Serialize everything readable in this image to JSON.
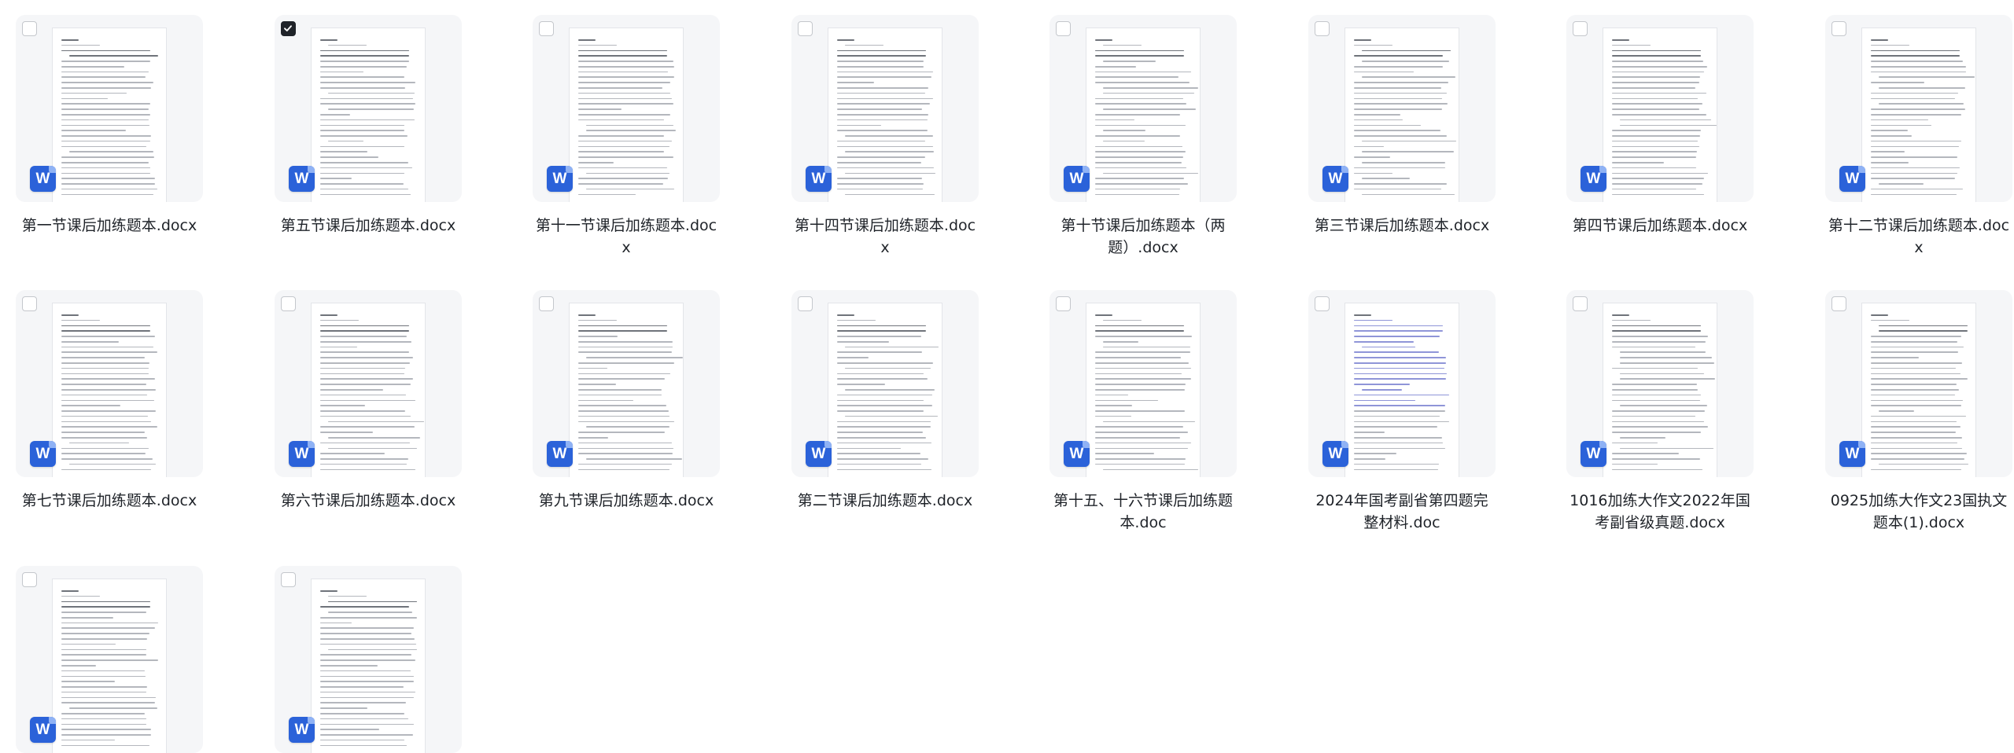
{
  "files": [
    {
      "name": "第一节课后加练题本.docx",
      "checked": false,
      "icon": "word-icon",
      "preview": "plain"
    },
    {
      "name": "第五节课后加练题本.docx",
      "checked": true,
      "icon": "word-icon",
      "preview": "plain"
    },
    {
      "name": "第十一节课后加练题本.docx",
      "checked": false,
      "icon": "word-icon",
      "preview": "plain"
    },
    {
      "name": "第十四节课后加练题本.docx",
      "checked": false,
      "icon": "word-icon",
      "preview": "plain"
    },
    {
      "name": "第十节课后加练题本（两题）.docx",
      "checked": false,
      "icon": "word-icon",
      "preview": "plain"
    },
    {
      "name": "第三节课后加练题本.docx",
      "checked": false,
      "icon": "word-icon",
      "preview": "plain"
    },
    {
      "name": "第四节课后加练题本.docx",
      "checked": false,
      "icon": "word-icon",
      "preview": "plain"
    },
    {
      "name": "第十二节课后加练题本.docx",
      "checked": false,
      "icon": "word-icon",
      "preview": "plain"
    },
    {
      "name": "第七节课后加练题本.docx",
      "checked": false,
      "icon": "word-icon",
      "preview": "plain"
    },
    {
      "name": "第六节课后加练题本.docx",
      "checked": false,
      "icon": "word-icon",
      "preview": "plain"
    },
    {
      "name": "第九节课后加练题本.docx",
      "checked": false,
      "icon": "word-icon",
      "preview": "plain"
    },
    {
      "name": "第二节课后加练题本.docx",
      "checked": false,
      "icon": "word-icon",
      "preview": "plain"
    },
    {
      "name": "第十五、十六节课后加练题本.doc",
      "checked": false,
      "icon": "word-icon",
      "preview": "plain"
    },
    {
      "name": "2024年国考副省第四题完整材料.doc",
      "checked": false,
      "icon": "word-icon",
      "preview": "colored"
    },
    {
      "name": "1016加练大作文2022年国考副省级真题.docx",
      "checked": false,
      "icon": "word-icon",
      "preview": "plain"
    },
    {
      "name": "0925加练大作文23国执文题本(1).docx",
      "checked": false,
      "icon": "word-icon",
      "preview": "plain"
    },
    {
      "name": "",
      "checked": false,
      "icon": "word-icon",
      "preview": "plain"
    },
    {
      "name": "",
      "checked": false,
      "icon": "word-icon",
      "preview": "plain"
    }
  ],
  "icon_letter": "W",
  "colors": {
    "tile_bg": "#f5f6f8",
    "word_blue": "#2b62d9",
    "text": "#1f2329",
    "checkbox_checked": "#1f2329"
  }
}
